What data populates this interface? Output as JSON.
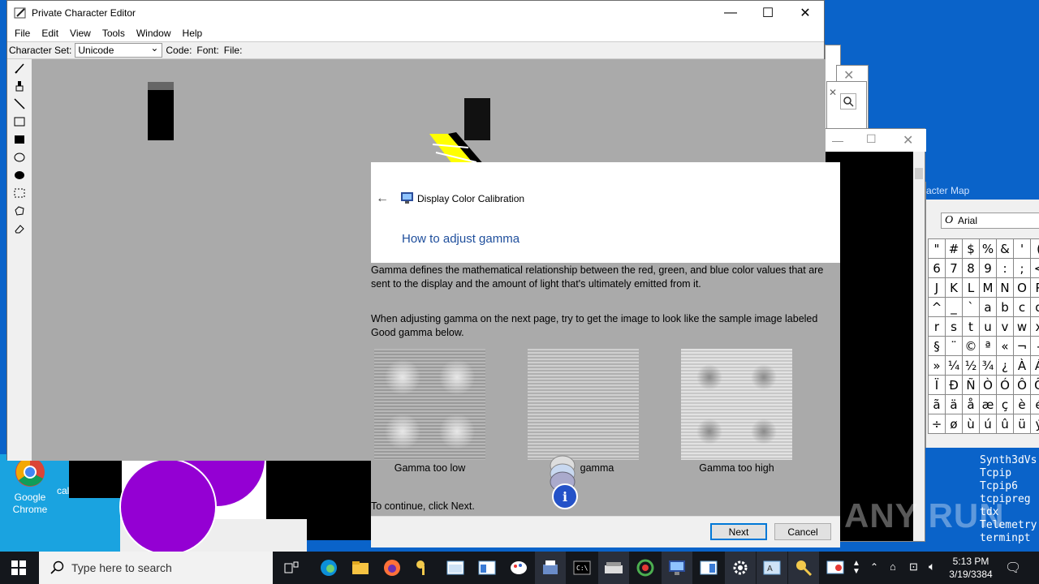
{
  "editor": {
    "title": "Private Character Editor",
    "menu": [
      "File",
      "Edit",
      "View",
      "Tools",
      "Window",
      "Help"
    ],
    "charset_label": "Character Set:",
    "charset_value": "Unicode",
    "code_label": "Code:",
    "font_label": "Font:",
    "file_label": "File:",
    "tools": [
      "pencil-icon",
      "brush-icon",
      "line-icon",
      "hollow-rectangle-icon",
      "filled-rectangle-icon",
      "hollow-ellipse-icon",
      "filled-ellipse-icon",
      "rectangular-selection-icon",
      "freeform-selection-icon",
      "eraser-icon"
    ]
  },
  "dialog": {
    "app_title": "Display Color Calibration",
    "heading": "How to adjust gamma",
    "para1": "Gamma defines the mathematical relationship between the red, green, and blue color values that are sent to the display and the amount of light that's ultimately emitted from it.",
    "para2": "When adjusting gamma on the next page, try to get the image to look like the sample image labeled Good gamma below.",
    "samples": [
      "Gamma too low",
      "gamma",
      "Gamma too high"
    ],
    "continue": "To continue, click Next.",
    "next": "Next",
    "cancel": "Cancel"
  },
  "charmap": {
    "title": "acter Map",
    "font": "Arial",
    "rows": [
      [
        "\"",
        "#",
        "$",
        "%",
        "&",
        "'",
        "("
      ],
      [
        "6",
        "7",
        "8",
        "9",
        ":",
        ";",
        "<"
      ],
      [
        "J",
        "K",
        "L",
        "M",
        "N",
        "O",
        "P"
      ],
      [
        "^",
        "_",
        "`",
        "a",
        "b",
        "c",
        "d"
      ],
      [
        "r",
        "s",
        "t",
        "u",
        "v",
        "w",
        "x"
      ],
      [
        "§",
        "¨",
        "©",
        "ª",
        "«",
        "¬",
        "-"
      ],
      [
        "»",
        "¼",
        "½",
        "¾",
        "¿",
        "À",
        "Á"
      ],
      [
        "Ï",
        "Ð",
        "Ñ",
        "Ò",
        "Ó",
        "Ô",
        "Õ"
      ],
      [
        "ã",
        "ä",
        "å",
        "æ",
        "ç",
        "è",
        "é"
      ],
      [
        "÷",
        "ø",
        "ù",
        "ú",
        "û",
        "ü",
        "ý"
      ]
    ]
  },
  "cmd": {
    "lines": [
      "Synth3dVs",
      "Tcpip",
      "Tcpip6",
      "tcpipreg",
      "tdx",
      "Telemetry",
      "terminpt"
    ]
  },
  "desktop": {
    "icons": [
      "Google Chrome",
      "calen"
    ]
  },
  "taskbar": {
    "search_placeholder": "Type here to search",
    "time": "5:13 PM",
    "date": "3/19/3384"
  },
  "watermark": "ANY RUN",
  "colors": {
    "accent": "#0078d7",
    "heading_blue": "#1e4e9c",
    "canvas_gray": "#aaaaaa",
    "purple": "#9400d3"
  }
}
